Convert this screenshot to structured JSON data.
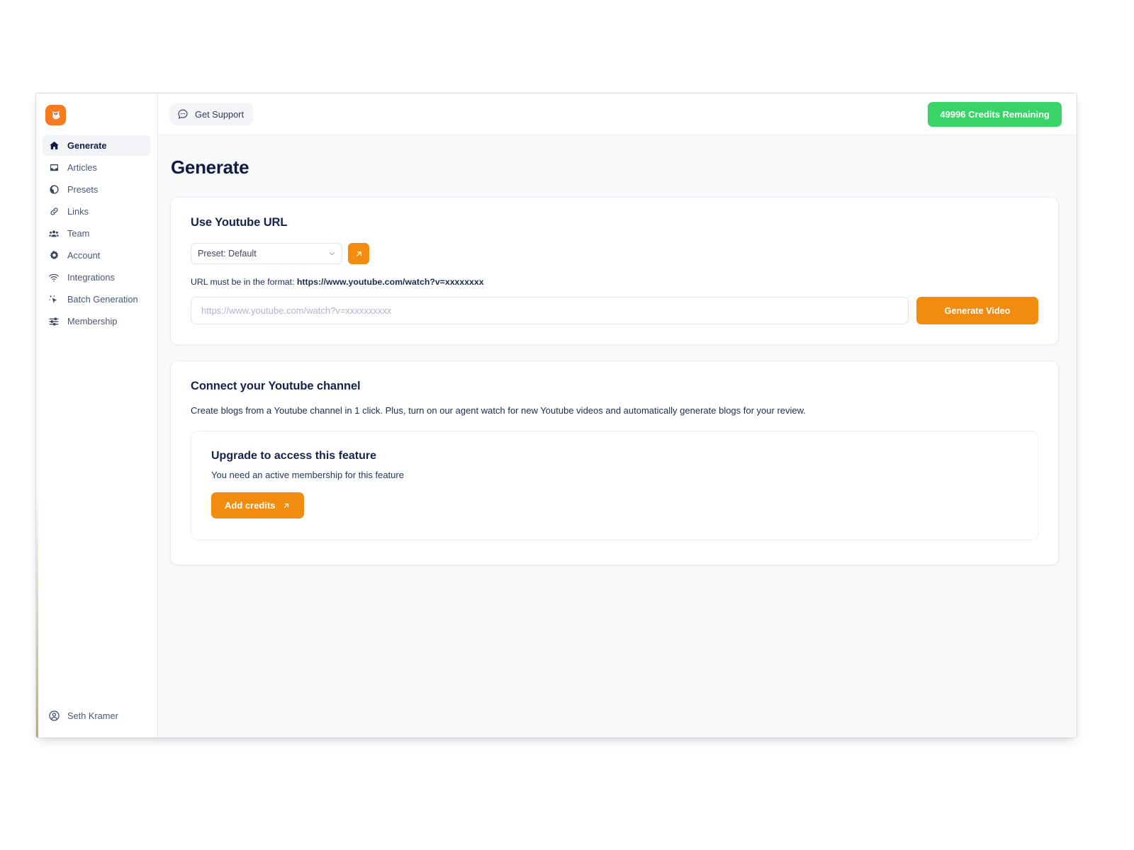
{
  "brand": {
    "logo_icon": "fox-logo-icon",
    "logo_bg": "#f47b20"
  },
  "sidebar": {
    "items": [
      {
        "label": "Generate",
        "icon": "home-icon",
        "active": true
      },
      {
        "label": "Articles",
        "icon": "inbox-tray-icon",
        "active": false
      },
      {
        "label": "Presets",
        "icon": "globe-icon",
        "active": false
      },
      {
        "label": "Links",
        "icon": "link-chain-icon",
        "active": false
      },
      {
        "label": "Team",
        "icon": "people-group-icon",
        "active": false
      },
      {
        "label": "Account",
        "icon": "gear-icon",
        "active": false
      },
      {
        "label": "Integrations",
        "icon": "wifi-icon",
        "active": false
      },
      {
        "label": "Batch Generation",
        "icon": "sparkle-cursor-icon",
        "active": false
      },
      {
        "label": "Membership",
        "icon": "sliders-icon",
        "active": false
      }
    ],
    "user": {
      "name": "Seth Kramer",
      "icon": "user-circle-icon"
    }
  },
  "topbar": {
    "support_label": "Get Support",
    "support_icon": "chat-bubble-dots-icon",
    "credits_label": "49996 Credits Remaining",
    "credits_color": "#3ad368"
  },
  "page": {
    "title": "Generate"
  },
  "url_card": {
    "title": "Use Youtube URL",
    "preset_selected": "Preset: Default",
    "preset_options": [
      "Preset: Default"
    ],
    "preset_open_icon": "arrow-up-right-icon",
    "hint_prefix": "URL must be in the format: ",
    "hint_format": "https://www.youtube.com/watch?v=xxxxxxxx",
    "url_placeholder": "https://www.youtube.com/watch?v=xxxxxxxxxx",
    "url_value": "",
    "generate_label": "Generate Video",
    "accent_color": "#f28c0f"
  },
  "channel_card": {
    "title": "Connect your Youtube channel",
    "description": "Create blogs from a Youtube channel in 1 click. Plus, turn on our agent watch for new Youtube videos and automatically generate blogs for your review.",
    "upgrade": {
      "title": "Upgrade to access this feature",
      "subtitle": "You need an active membership for this feature",
      "button_label": "Add credits",
      "button_icon": "arrow-up-right-icon"
    }
  }
}
